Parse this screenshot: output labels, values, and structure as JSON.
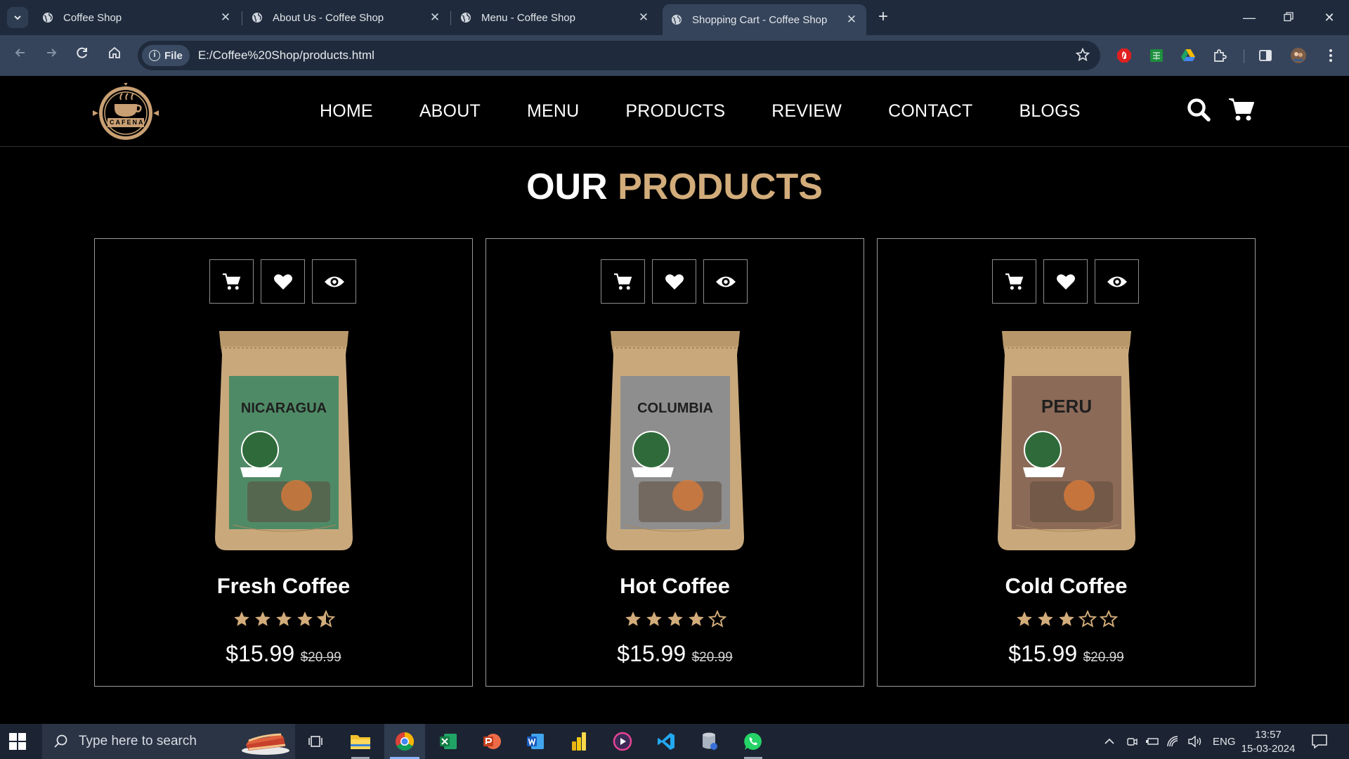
{
  "browser": {
    "tabs": [
      {
        "title": "Coffee Shop",
        "active": false
      },
      {
        "title": "About Us - Coffee Shop",
        "active": false
      },
      {
        "title": "Menu - Coffee Shop",
        "active": false
      },
      {
        "title": "Shopping Cart - Coffee Shop",
        "active": true
      }
    ],
    "address": {
      "scheme_label": "File",
      "url": "E:/Coffee%20Shop/products.html"
    }
  },
  "site": {
    "logo_text": "CAFENA",
    "nav": [
      "HOME",
      "ABOUT",
      "MENU",
      "PRODUCTS",
      "REVIEW",
      "CONTACT",
      "BLOGS"
    ],
    "section_title": {
      "prefix": "OUR",
      "accent": "PRODUCTS"
    },
    "accent_color": "#d2ac7a",
    "products": [
      {
        "name": "Fresh Coffee",
        "rating": 4.5,
        "price": "$15.99",
        "old_price": "$20.99",
        "bag_label": "NICARAGUA",
        "bag_color": "#4f8a66"
      },
      {
        "name": "Hot Coffee",
        "rating": 4,
        "price": "$15.99",
        "old_price": "$20.99",
        "bag_label": "COLUMBIA",
        "bag_color": "#8e8e8e"
      },
      {
        "name": "Cold Coffee",
        "rating": 3,
        "price": "$15.99",
        "old_price": "$20.99",
        "bag_label": "PERU",
        "bag_color": "#8c6a58"
      }
    ]
  },
  "taskbar": {
    "search_placeholder": "Type here to search",
    "language": "ENG",
    "time": "13:57",
    "date": "15-03-2024"
  }
}
